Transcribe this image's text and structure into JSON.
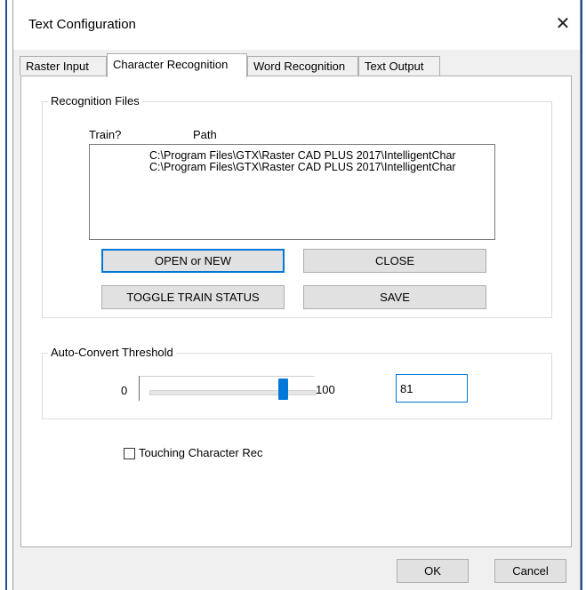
{
  "window": {
    "title": "Text Configuration",
    "close_symbol": "✕"
  },
  "tabs": [
    {
      "label": "Raster Input",
      "active": false
    },
    {
      "label": "Character Recognition",
      "active": true
    },
    {
      "label": "Word Recognition",
      "active": false
    },
    {
      "label": "Text Output",
      "active": false
    }
  ],
  "recognition_files": {
    "group_label": "Recognition Files",
    "columns": [
      "Train?",
      "Path"
    ],
    "rows": [
      {
        "train": "",
        "path": "C:\\Program Files\\GTX\\Raster CAD PLUS 2017\\IntelligentChar"
      },
      {
        "train": "",
        "path": "C:\\Program Files\\GTX\\Raster CAD PLUS 2017\\IntelligentChar"
      }
    ],
    "buttons": {
      "open_new": "OPEN or NEW",
      "close": "CLOSE",
      "toggle_train": "TOGGLE TRAIN STATUS",
      "save": "SAVE"
    }
  },
  "auto_convert": {
    "group_label": "Auto-Convert Threshold",
    "min_label": "0",
    "max_label": "100",
    "value": 81,
    "value_text": "81"
  },
  "touching_character": {
    "label": "Touching Character Rec",
    "checked": false
  },
  "footer": {
    "ok": "OK",
    "cancel": "Cancel"
  },
  "colors": {
    "accent": "#0078d7",
    "dialog_bg": "#f0f0f0",
    "panel_bg": "#ffffff"
  }
}
